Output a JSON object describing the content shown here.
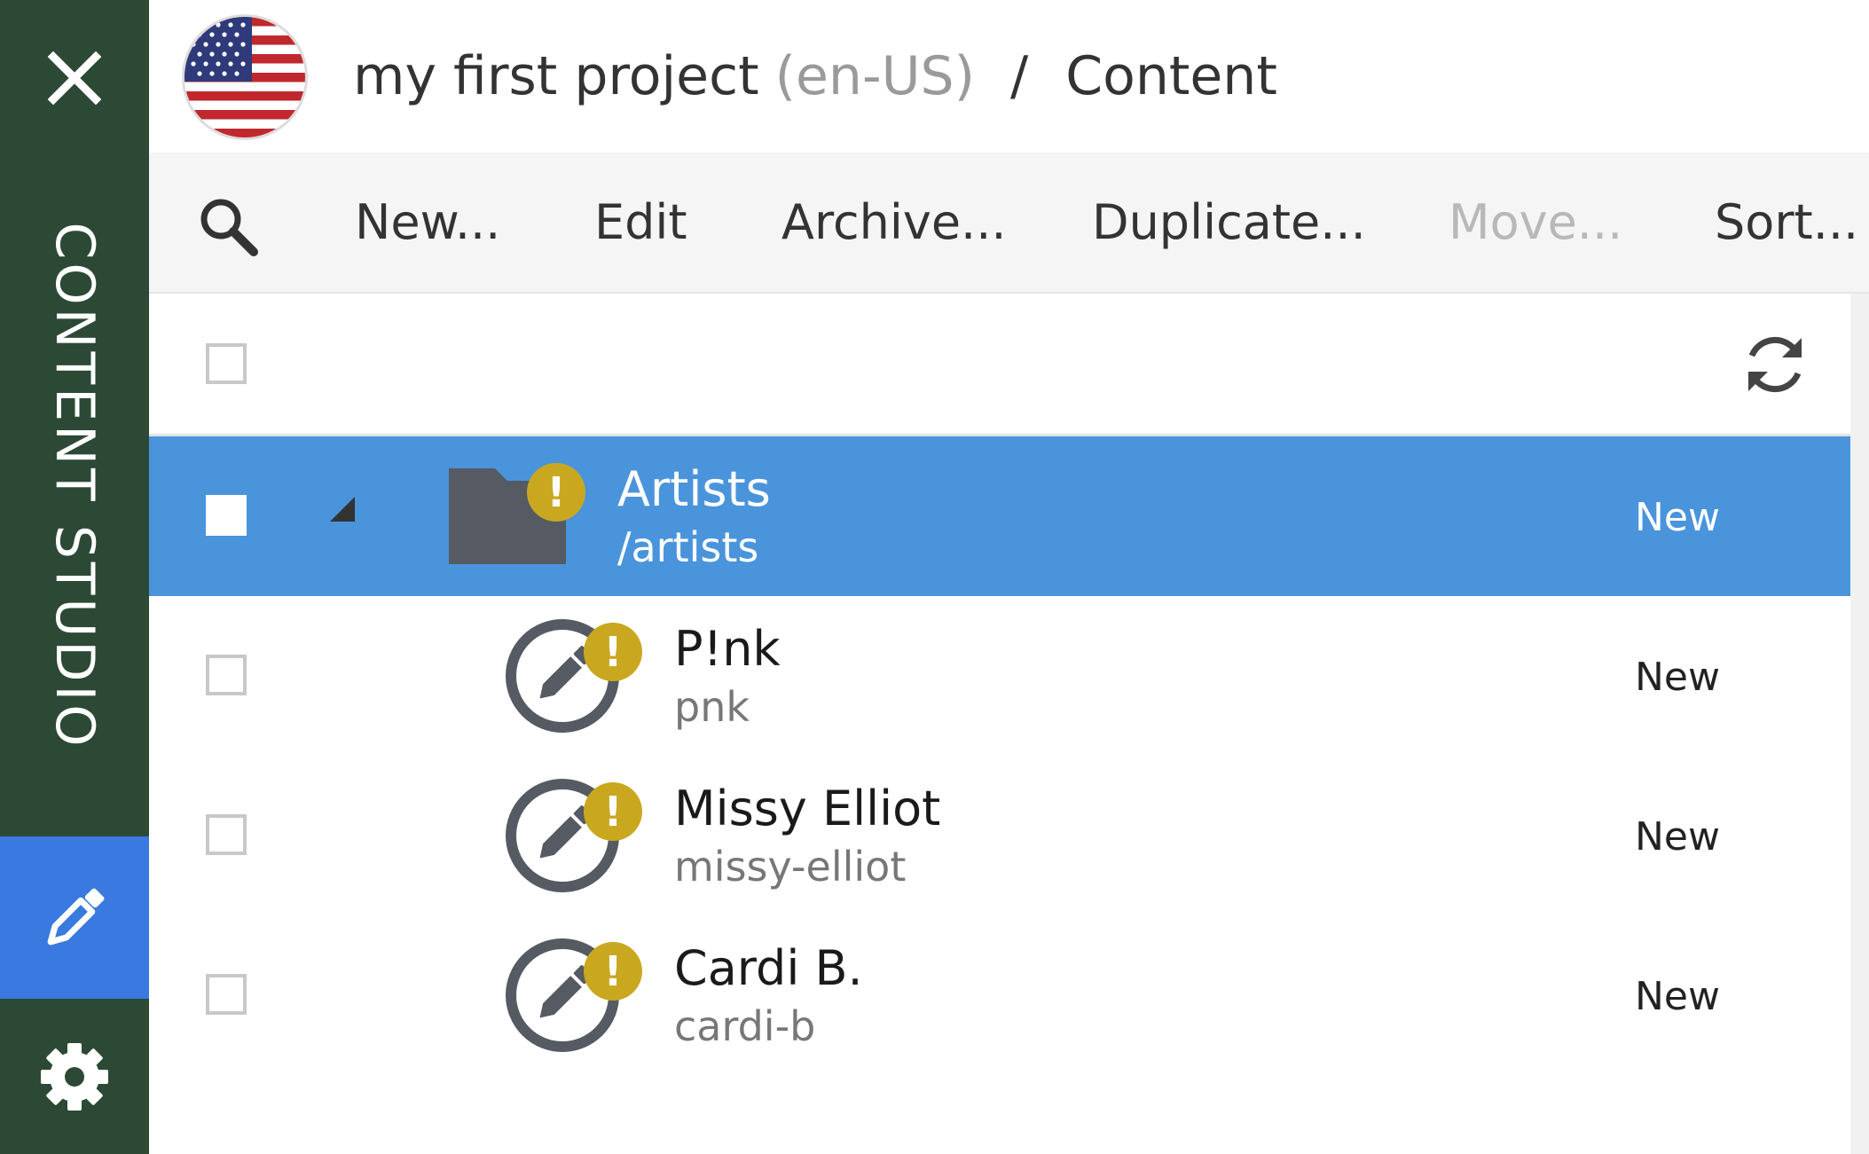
{
  "sidebar": {
    "close_icon": "close-icon",
    "app_name": "CONTENT STUDIO",
    "nav_content_icon": "pencil-icon",
    "nav_settings_icon": "gear-icon",
    "active_color": "#3a79df",
    "bg_color": "#2c4936"
  },
  "header": {
    "flag_icon": "us-flag-icon",
    "project": "my first project",
    "language": "(en-US)",
    "separator": "/",
    "section": "Content"
  },
  "toolbar": {
    "search_icon": "search-icon",
    "buttons": [
      {
        "label": "New...",
        "enabled": true
      },
      {
        "label": "Edit",
        "enabled": true
      },
      {
        "label": "Archive...",
        "enabled": true
      },
      {
        "label": "Duplicate...",
        "enabled": true
      },
      {
        "label": "Move...",
        "enabled": false
      },
      {
        "label": "Sort...",
        "enabled": true
      }
    ]
  },
  "grid": {
    "select_all_checked": false,
    "refresh_icon": "refresh-icon",
    "rows": [
      {
        "name": "Artists",
        "path": "/artists",
        "status": "New",
        "type": "folder",
        "selected": true,
        "expanded": true,
        "warning": "!"
      },
      {
        "name": "P!nk",
        "path": "pnk",
        "status": "New",
        "type": "content",
        "selected": false,
        "warning": "!"
      },
      {
        "name": "Missy Elliot",
        "path": "missy-elliot",
        "status": "New",
        "type": "content",
        "selected": false,
        "warning": "!"
      },
      {
        "name": "Cardi B.",
        "path": "cardi-b",
        "status": "New",
        "type": "content",
        "selected": false,
        "warning": "!"
      }
    ],
    "selected_row_color": "#4a94dc",
    "warning_color": "#c9a820"
  }
}
